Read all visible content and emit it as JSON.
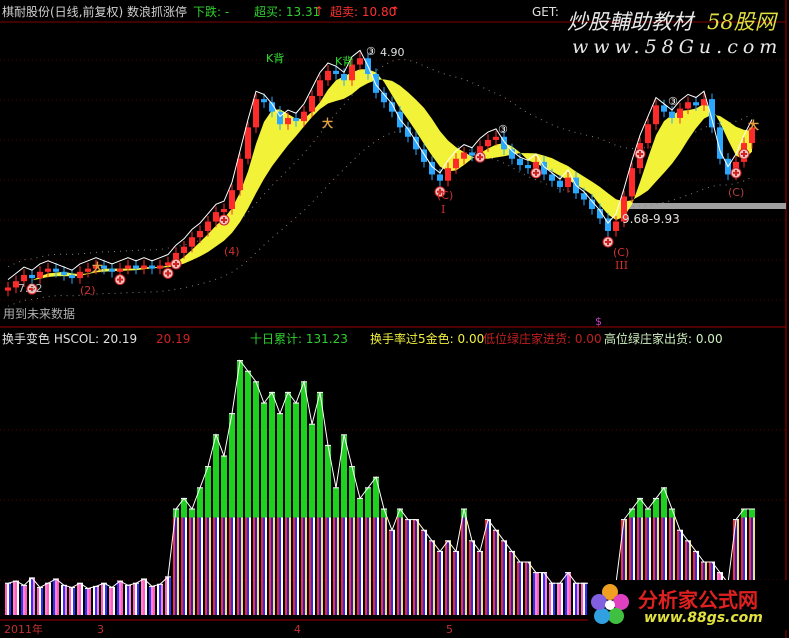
{
  "header": {
    "title": "棋耐股份(日线,前复权) 数浪抓涨停",
    "fall_label": "下跌: -",
    "overbought_label": "超买: 13.31",
    "oversold_label": "超卖: 10.80",
    "get_label": "GET:",
    "arrow": "↑"
  },
  "sub_header": {
    "hscol": "换手变色 HSCOL: 20.19",
    "hscol2": "20.19",
    "ten_day": "十日累计: 131.23",
    "gold": "换手率过5金色: 0.00",
    "low_green": "低位绿庄家进货: 0.00",
    "high_green": "高位绿庄家出货: 0.00"
  },
  "notes": {
    "future_data": "用到未来数据",
    "low_price": "7.32",
    "high_price": "4.90",
    "range_label": "9.68-9.93",
    "dollar": "$"
  },
  "annotations": {
    "k_back": "K背",
    "wave2": "(2)",
    "wave4": "(4)",
    "wave3": "③",
    "waveC": "(C)",
    "roman1": "I",
    "roman3": "III",
    "person": "大"
  },
  "x_axis": {
    "year": "2011年",
    "m3": "3",
    "m4": "4",
    "m5": "5"
  },
  "watermarks": {
    "top_cn": "炒股輔助教材",
    "top_brand": "58股网",
    "top_url": "www.58Gu.com",
    "bottom_cn": "分析家公式网",
    "bottom_url": "www.88gs.com"
  },
  "colors": {
    "up": "#ff2a2a",
    "down": "#2aa8ff",
    "band": "#ffff3c",
    "green": "#20d020",
    "axis": "#a00000"
  },
  "chart_data": [
    {
      "type": "line",
      "title": "棋耐股份(日线,前复权) 数浪抓涨停",
      "ylim": [
        7.32,
        14.9
      ],
      "series": [
        {
          "name": "close",
          "values": [
            7.4,
            7.6,
            7.8,
            7.7,
            7.9,
            8.0,
            7.9,
            7.8,
            7.7,
            7.9,
            8.0,
            8.1,
            8.0,
            7.9,
            8.0,
            8.1,
            8.0,
            8.1,
            8.0,
            8.1,
            8.2,
            8.5,
            8.7,
            9.0,
            9.2,
            9.5,
            9.8,
            9.9,
            10.5,
            11.5,
            12.5,
            13.4,
            13.3,
            13.0,
            12.6,
            12.8,
            12.7,
            13.0,
            13.5,
            14.0,
            14.3,
            14.2,
            14.0,
            14.5,
            14.7,
            14.2,
            13.6,
            13.3,
            13.0,
            12.5,
            12.2,
            11.8,
            11.4,
            11.0,
            10.8,
            11.2,
            11.5,
            11.7,
            11.6,
            11.9,
            12.1,
            12.2,
            11.8,
            11.5,
            11.3,
            11.2,
            11.4,
            11.0,
            10.8,
            10.6,
            10.9,
            10.4,
            10.2,
            9.9,
            9.6,
            9.2,
            9.5,
            10.3,
            11.2,
            12.0,
            12.6,
            13.2,
            13.0,
            12.8,
            13.1,
            13.3,
            13.2,
            13.4,
            12.5,
            11.5,
            11.0,
            11.4,
            12.0,
            12.5
          ]
        }
      ]
    },
    {
      "type": "bar",
      "title": "换手变色 HSCOL",
      "ylim": [
        0,
        25
      ],
      "series": [
        {
          "name": "turnover",
          "values": [
            3,
            3.2,
            2.8,
            3.5,
            2.6,
            3,
            3.4,
            2.8,
            2.6,
            3,
            2.5,
            2.7,
            3,
            2.6,
            3.2,
            2.8,
            3,
            3.4,
            2.7,
            2.9,
            3.6,
            10,
            11,
            10,
            12,
            14,
            17,
            15,
            19,
            24,
            23,
            22,
            20,
            21,
            19,
            21,
            20,
            22,
            18,
            21,
            16,
            12,
            17,
            14,
            11,
            12,
            13,
            10,
            8,
            10,
            9,
            9,
            8,
            7,
            6,
            7,
            6,
            10,
            7,
            6,
            9,
            8,
            7,
            6,
            5,
            5,
            4,
            4,
            3,
            3,
            4,
            3,
            3,
            3,
            3,
            3,
            3,
            9,
            10,
            11,
            10,
            11,
            12,
            10,
            8,
            7,
            6,
            5,
            5,
            4,
            3,
            9,
            10,
            10
          ]
        }
      ]
    }
  ]
}
